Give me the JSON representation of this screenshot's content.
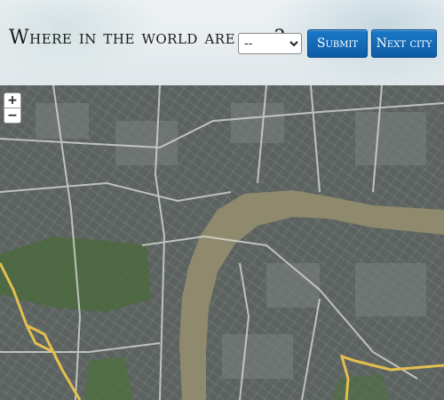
{
  "header": {
    "title": "Where in the world are you?",
    "select_value": "--",
    "submit_label": "Submit",
    "next_label": "Next city"
  },
  "map": {
    "zoom_in": "+",
    "zoom_out": "−",
    "colors": {
      "river": "#8f8a6e",
      "park": "#4b6a3e",
      "road": "#d9d9d4",
      "highway": "#e5bf4f",
      "button": "#1268b5"
    }
  }
}
